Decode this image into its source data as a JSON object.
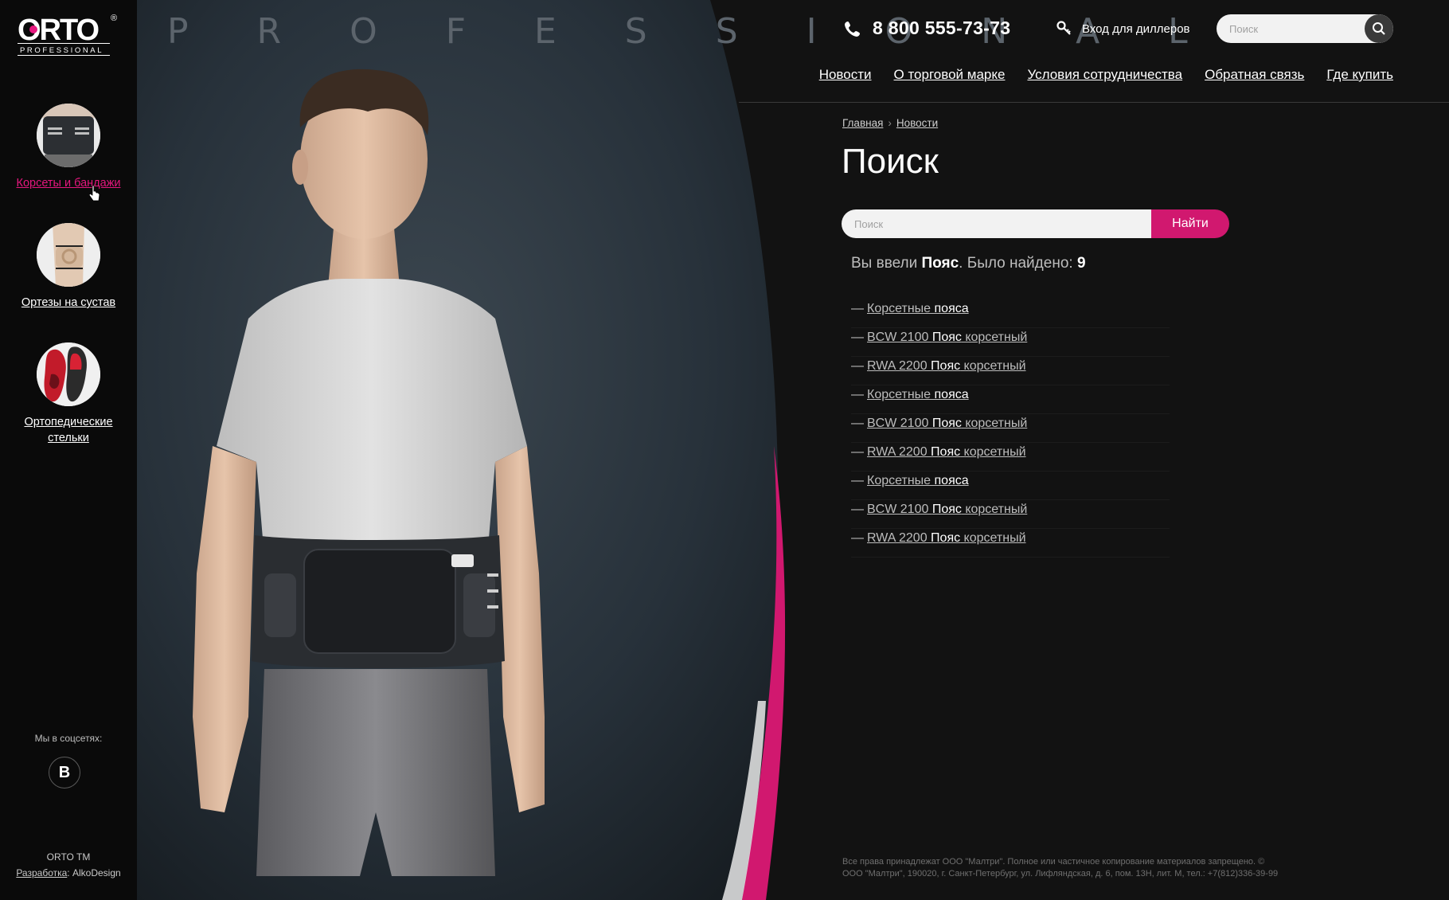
{
  "brand": {
    "logo_text": "ORTO",
    "logo_sub": "PROFESSIONAL",
    "reg_mark": "®",
    "hero_word": "P R O F E S S I O N A L"
  },
  "sidebar": {
    "categories": [
      {
        "label": "Корсеты и бандажи",
        "active": true
      },
      {
        "label": "Ортезы на сустав",
        "active": false
      },
      {
        "label": "Ортопедические стельки",
        "active": false
      }
    ],
    "social_title": "Мы в соцсетях:",
    "vk_label": "В",
    "brand_tm": "ORTO TM",
    "dev_label": "Разработка",
    "dev_sep": ": ",
    "dev_name": "AlkoDesign"
  },
  "header": {
    "phone": "8 800 555-73-73",
    "dealer_login": "Вход для диллеров",
    "search_placeholder": "Поиск",
    "nav": [
      "Новости",
      "О торговой марке",
      "Условия сотрудничества",
      "Обратная связь",
      "Где купить"
    ]
  },
  "breadcrumb": [
    "Главная",
    "Новости"
  ],
  "page_title": "Поиск",
  "search_form": {
    "placeholder": "Поиск",
    "button": "Найти"
  },
  "result_summary": {
    "prefix": "Вы ввели ",
    "query": "Пояс",
    "middle": ". Было найдено: ",
    "count": "9"
  },
  "results": [
    {
      "pre": "Корсетные ",
      "hl": "пояса",
      "post": ""
    },
    {
      "pre": "BCW 2100 ",
      "hl": "Пояс",
      "post": " корсетный"
    },
    {
      "pre": "RWA 2200 ",
      "hl": "Пояс",
      "post": " корсетный"
    },
    {
      "pre": "Корсетные ",
      "hl": "пояса",
      "post": ""
    },
    {
      "pre": "BCW 2100 ",
      "hl": "Пояс",
      "post": " корсетный"
    },
    {
      "pre": "RWA 2200 ",
      "hl": "Пояс",
      "post": " корсетный"
    },
    {
      "pre": "Корсетные ",
      "hl": "пояса",
      "post": ""
    },
    {
      "pre": "BCW 2100 ",
      "hl": "Пояс",
      "post": " корсетный"
    },
    {
      "pre": "RWA 2200 ",
      "hl": "Пояс",
      "post": " корсетный"
    }
  ],
  "footer": {
    "line1": "Все права принадлежат ООО \"Малтри\". Полное или частичное копирование материалов запрещено. ©",
    "line2": "ООО \"Малтри\", 190020, г. Санкт-Петербург, ул. Лифляндская, д. 6, пом. 13Н, лит. М, тел.: +7(812)336-39-99"
  },
  "colors": {
    "accent": "#d1186f",
    "active_link": "#e5177e",
    "background": "#121212",
    "sidebar": "#0a0a0a"
  },
  "icons": [
    "phone-icon",
    "key-icon",
    "search-icon",
    "cursor-icon",
    "vk-icon"
  ]
}
